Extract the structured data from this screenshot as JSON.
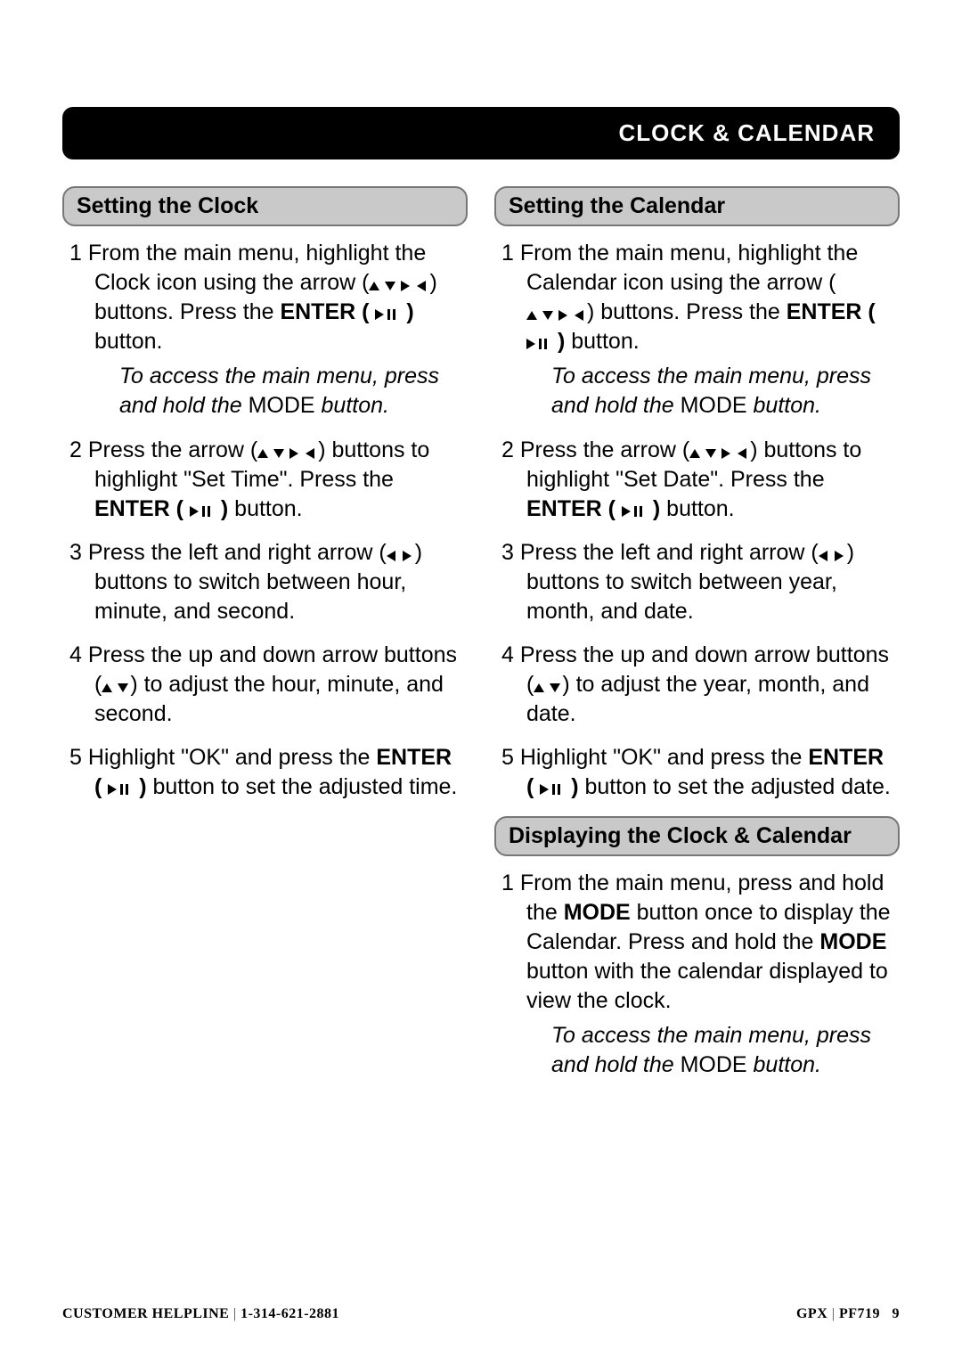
{
  "header": {
    "title": "CLOCK & CALENDAR"
  },
  "icons": {
    "arrows4": "up-down-right-left-icon",
    "arrows_lr": "left-right-icon",
    "arrows_ud": "up-down-icon",
    "enter": "play-pause-icon"
  },
  "left": {
    "heading": "Setting the Clock",
    "steps": {
      "s1a": "From the main menu, highlight the Clock icon using the arrow (",
      "s1b": ") buttons. Press the ",
      "s1c": "ENTER ( ",
      "s1d": " ) ",
      "s1e": "button.",
      "tip_a": "To access the main menu, press and hold the ",
      "tip_b": "MODE",
      "tip_c": " button.",
      "s2a": "Press the arrow (",
      "s2b": ") buttons to highlight \"Set Time\". Press the ",
      "s2c": "ENTER ( ",
      "s2d": " ) ",
      "s2e": "button.",
      "s3a": "Press the left and right arrow (",
      "s3b": ") buttons to switch between hour, minute, and second.",
      "s4a": "Press the up and down arrow buttons (",
      "s4b": ") to adjust the hour, minute, and second.",
      "s5a": "Highlight \"OK\" and press the ",
      "s5b": "ENTER ( ",
      "s5c": " ) ",
      "s5d": "button to set the adjusted time."
    }
  },
  "right": {
    "heading": "Setting the Calendar",
    "steps": {
      "s1a": "From the main menu, highlight the Calendar icon using the arrow (",
      "s1b": ") buttons. Press the ",
      "s1c": "ENTER ( ",
      "s1d": " ) ",
      "s1e": "button.",
      "tip_a": "To access the main menu, press and hold the ",
      "tip_b": "MODE",
      "tip_c": " button.",
      "s2a": "Press the arrow (",
      "s2b": ") buttons to highlight \"Set Date\". Press the ",
      "s2c": "ENTER ( ",
      "s2d": " ) ",
      "s2e": "button.",
      "s3a": "Press the left and right arrow (",
      "s3b": ") buttons to switch between year, month, and date.",
      "s4a": "Press the up and down arrow buttons (",
      "s4b": ") to adjust the year, month, and date.",
      "s5a": "Highlight \"OK\" and press the ",
      "s5b": "ENTER ( ",
      "s5c": " ) ",
      "s5d": "button to set the adjusted date."
    },
    "heading2": "Displaying the Clock & Calendar",
    "display": {
      "s1a": "From the main menu, press and hold the ",
      "s1b": "MODE",
      "s1c": " button once to display the Calendar. Press and hold the ",
      "s1d": "MODE",
      "s1e": " button with the calendar displayed to view the clock.",
      "tip_a": "To access the main menu, press and hold the ",
      "tip_b": "MODE",
      "tip_c": " button."
    }
  },
  "footer": {
    "helpline_label": "CUSTOMER HELPLINE",
    "helpline_sep": "  |  ",
    "helpline_number": "1-314-621-2881",
    "brand": "GPX",
    "sep2": "  |  ",
    "model": "PF719",
    "page": "9"
  }
}
